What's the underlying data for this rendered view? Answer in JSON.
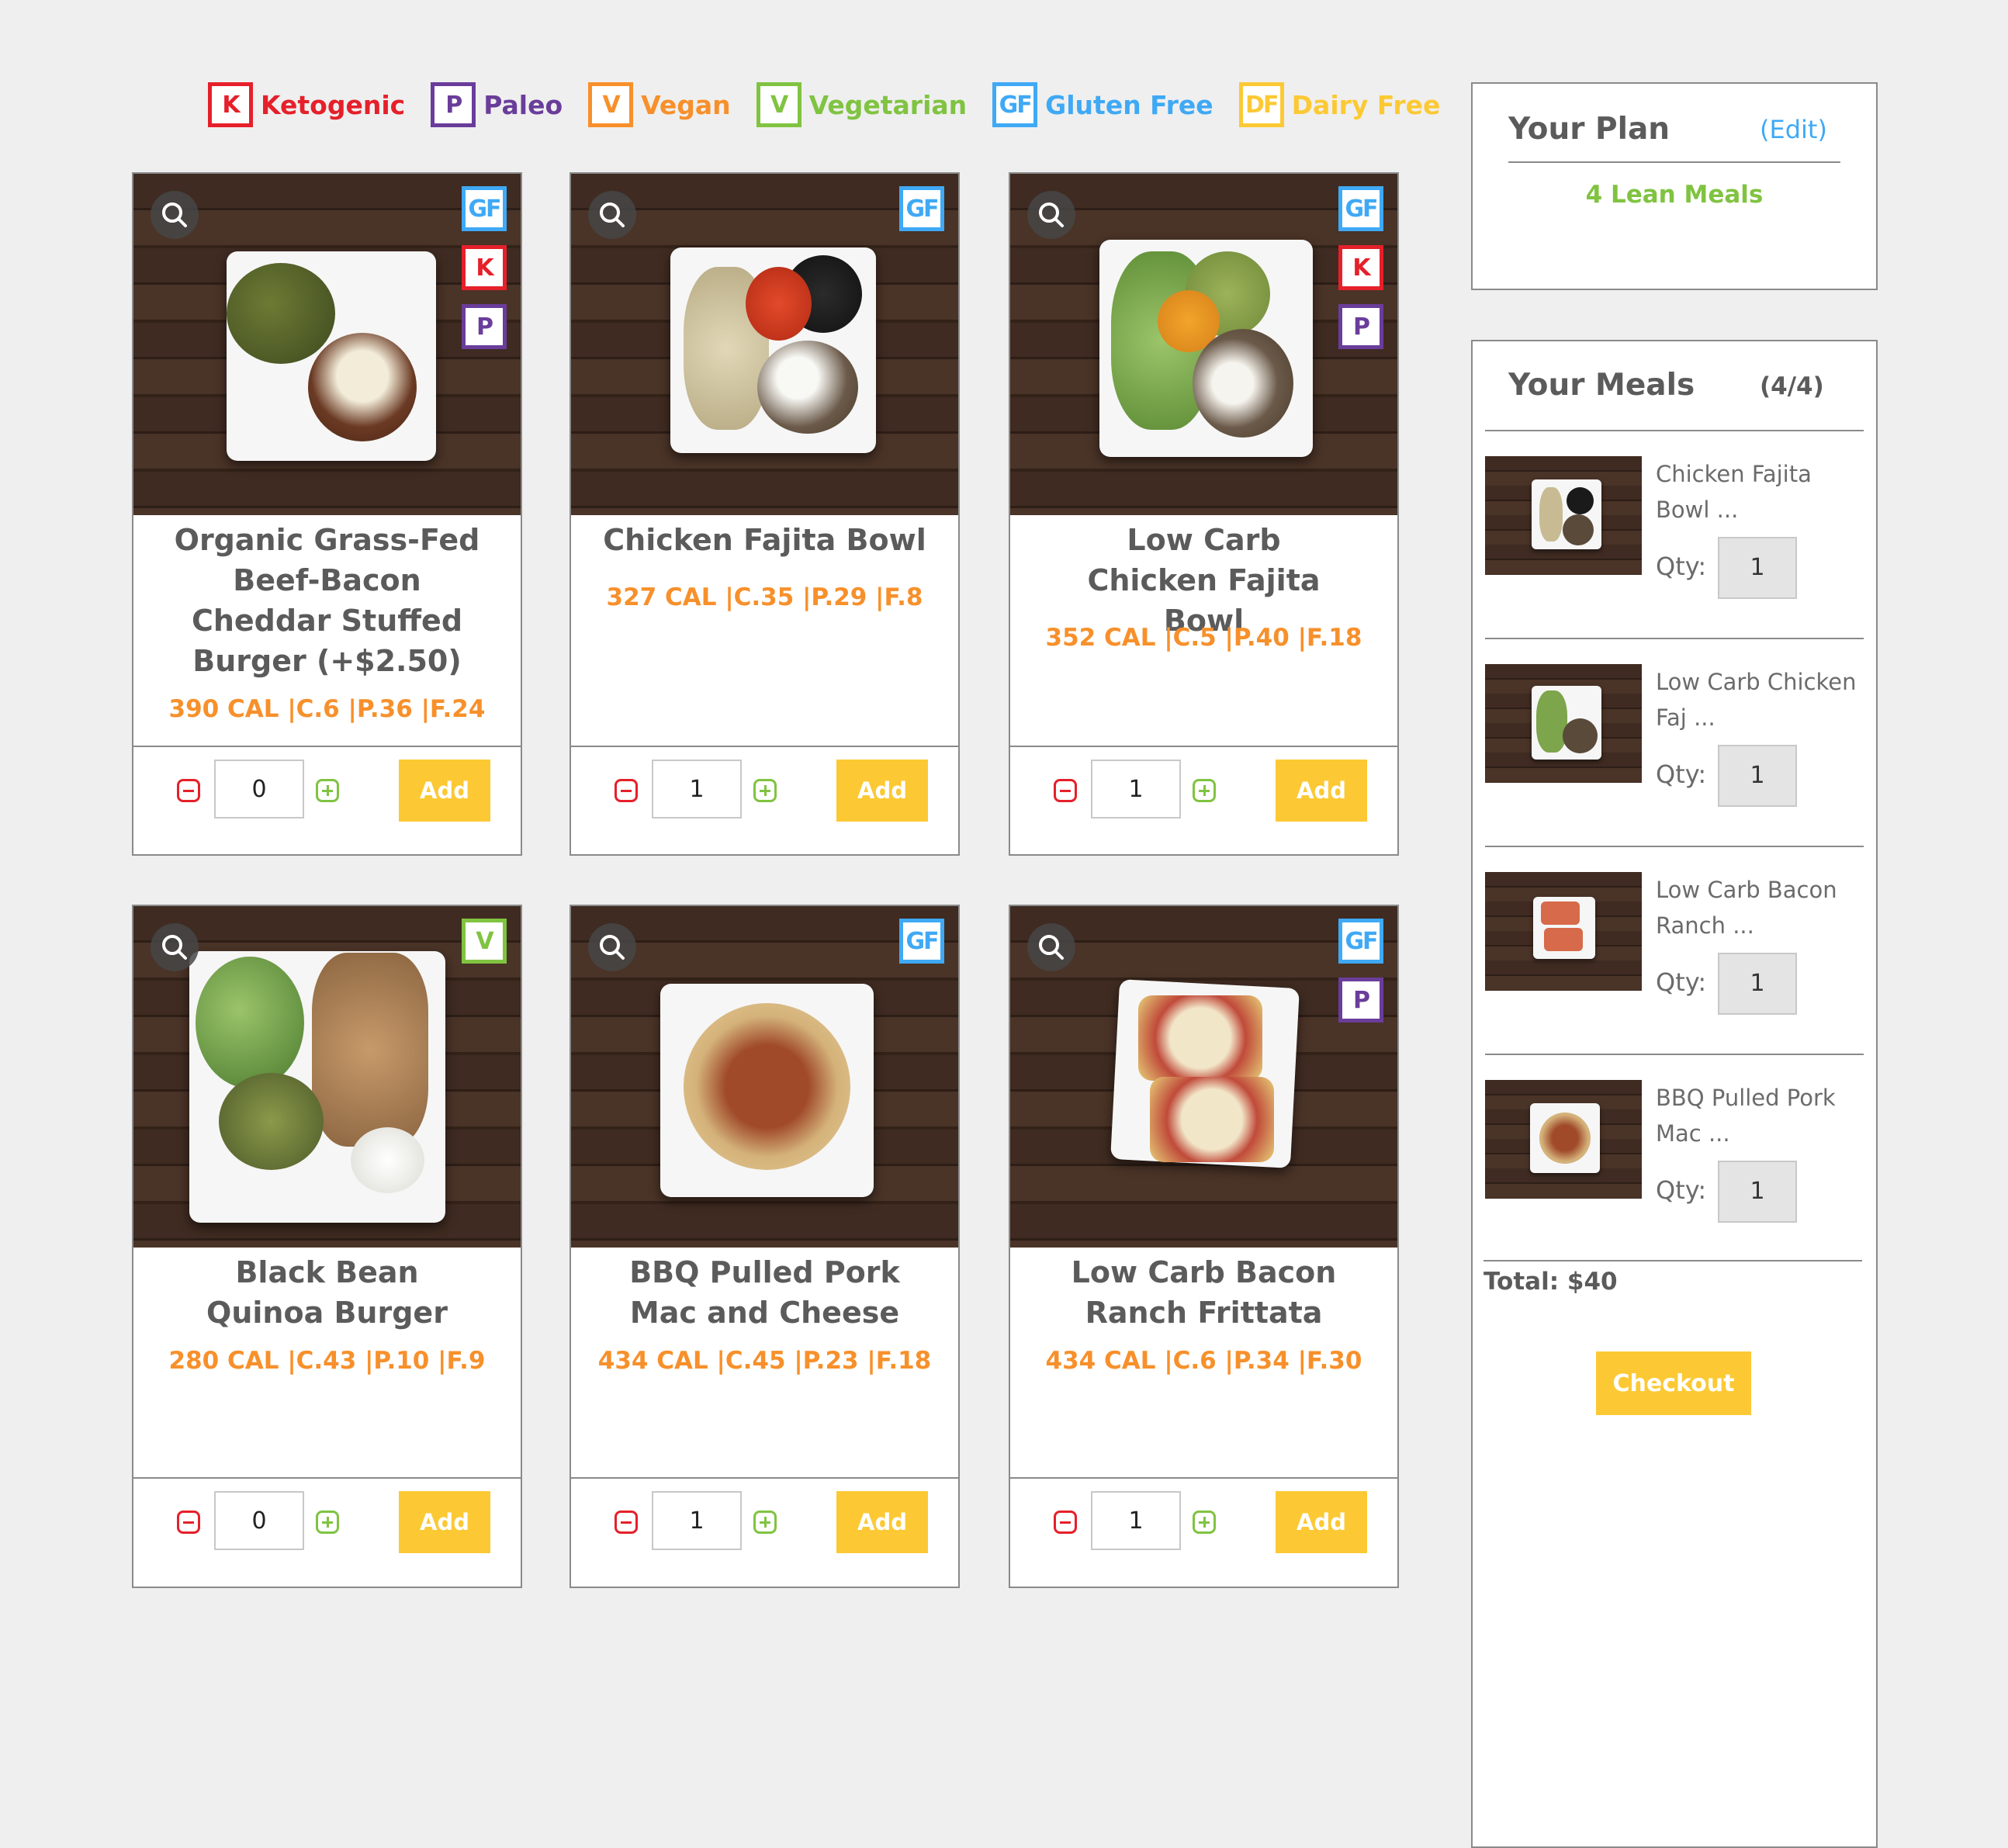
{
  "legend": [
    {
      "code": "K",
      "label": "Ketogenic",
      "color": "#e5202a"
    },
    {
      "code": "P",
      "label": "Paleo",
      "color": "#6a3d9a"
    },
    {
      "code": "V",
      "label": "Vegan",
      "color": "#f7902b"
    },
    {
      "code": "V",
      "label": "Vegetarian",
      "color": "#80c341"
    },
    {
      "code": "GF",
      "label": "Gluten Free",
      "color": "#3fa9f5"
    },
    {
      "code": "DF",
      "label": "Dairy Free",
      "color": "#fcc935"
    }
  ],
  "meals": [
    {
      "name": "Organic Grass-Fed Beef-Bacon Cheddar Stuffed Burger (+$2.50)",
      "macros": "390 CAL |C.6 |P.36 |F.24",
      "qty": "0",
      "add_label": "Add",
      "badges": [
        "GF",
        "K",
        "P"
      ]
    },
    {
      "name": "Chicken Fajita Bowl",
      "macros": "327 CAL |C.35 |P.29 |F.8",
      "qty": "1",
      "add_label": "Add",
      "badges": [
        "GF"
      ]
    },
    {
      "name": "Low Carb Chicken Fajita Bowl",
      "macros": "352 CAL |C.5 |P.40 |F.18",
      "qty": "1",
      "add_label": "Add",
      "badges": [
        "GF",
        "K",
        "P"
      ]
    },
    {
      "name": "Black Bean Quinoa Burger",
      "macros": "280 CAL |C.43 |P.10 |F.9",
      "qty": "0",
      "add_label": "Add",
      "badges": [
        "V"
      ]
    },
    {
      "name": "BBQ Pulled Pork Mac and Cheese",
      "macros": "434 CAL |C.45 |P.23 |F.18",
      "qty": "1",
      "add_label": "Add",
      "badges": [
        "GF"
      ]
    },
    {
      "name": "Low Carb Bacon Ranch Frittata",
      "macros": "434 CAL |C.6 |P.34 |F.30",
      "qty": "1",
      "add_label": "Add",
      "badges": [
        "GF",
        "P"
      ]
    }
  ],
  "plan": {
    "title": "Your Plan",
    "edit_label": "(Edit)",
    "plan_name": "4 Lean Meals"
  },
  "cart": {
    "title": "Your Meals",
    "count": "(4/4)",
    "qty_label": "Qty:",
    "items": [
      {
        "name": "Chicken Fajita Bowl ...",
        "qty": "1"
      },
      {
        "name": "Low Carb Chicken Faj ...",
        "qty": "1"
      },
      {
        "name": "Low Carb Bacon Ranch ...",
        "qty": "1"
      },
      {
        "name": "BBQ Pulled Pork Mac ...",
        "qty": "1"
      }
    ],
    "total": "Total: $40",
    "checkout_label": "Checkout"
  },
  "colors": {
    "accent_yellow": "#fcc935",
    "macro_orange": "#f7902b",
    "plan_green": "#80c341",
    "link_blue": "#3fa9f5",
    "minus_red": "#e5202a"
  }
}
